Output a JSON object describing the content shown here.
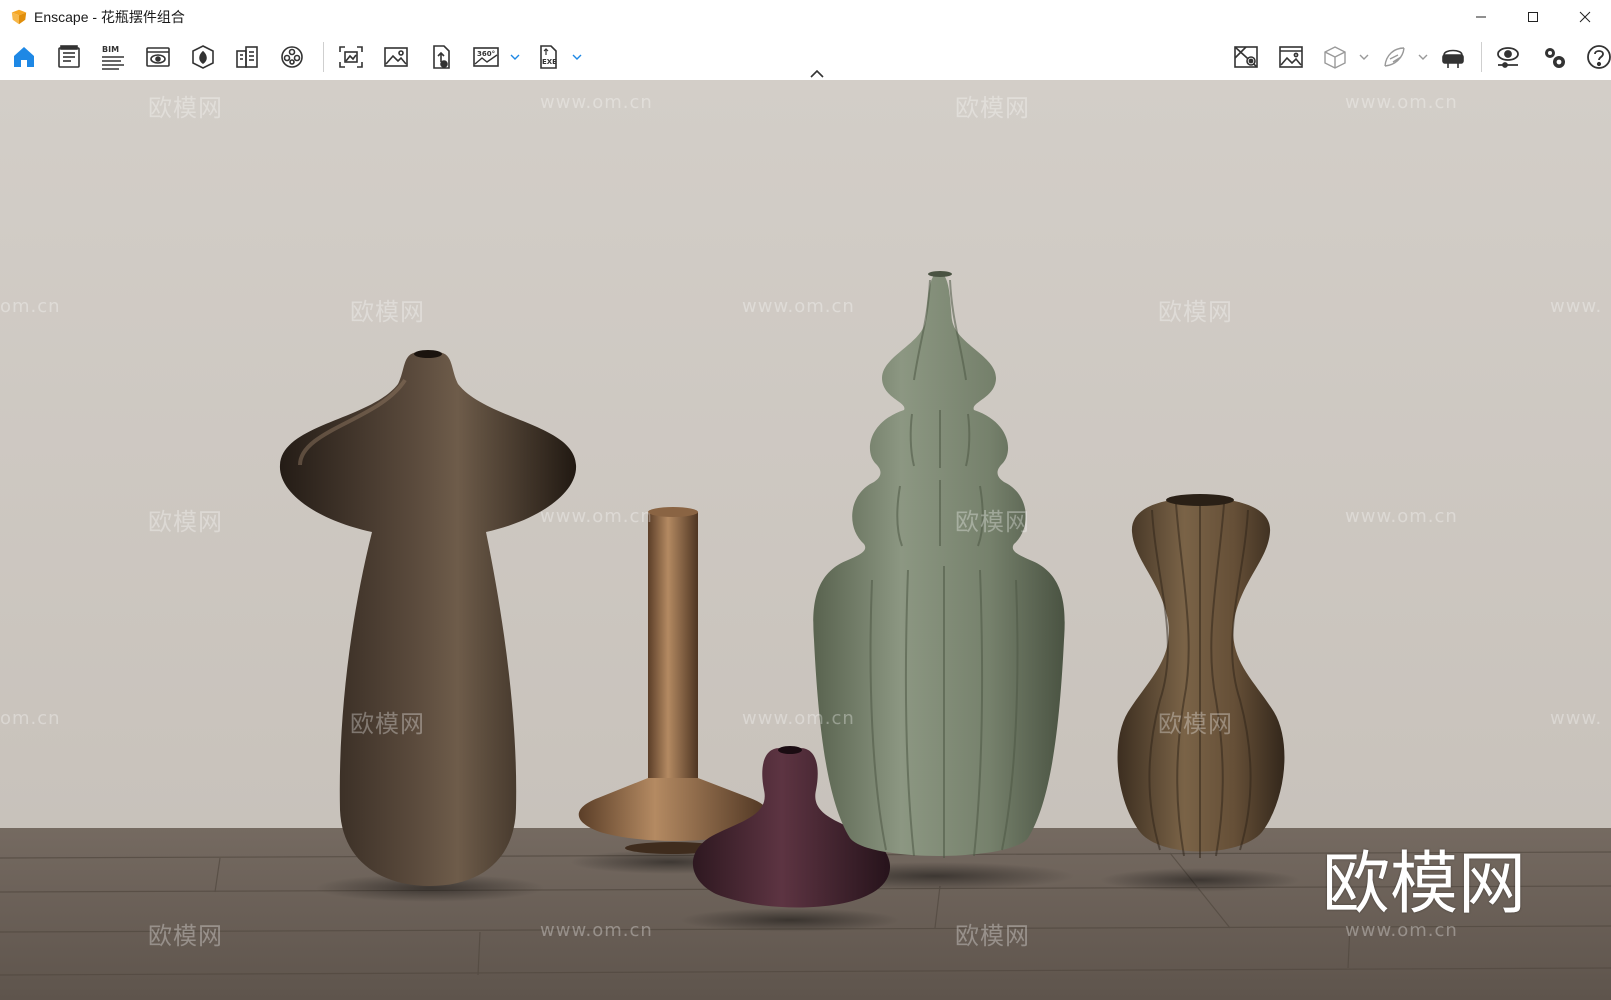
{
  "window": {
    "title": "Enscape - 花瓶摆件组合",
    "controls": [
      "minimize-icon",
      "maximize-icon",
      "close-icon"
    ]
  },
  "toolbar": {
    "left_icons": [
      "home-icon",
      "document-list-icon",
      "bim-icon",
      "view-eye-icon",
      "material-icon",
      "building-icon",
      "video-reel-icon",
      "screenshot-icon",
      "image-icon",
      "upload-file-icon",
      "panorama-360-icon",
      "export-exe-icon"
    ],
    "right_icons": [
      "map-pin-icon",
      "image-gallery-icon",
      "cube-icon",
      "feather-icon",
      "vr-headset-icon",
      "visual-settings-eye-icon",
      "settings-gears-icon",
      "help-icon"
    ],
    "bim_label": "BIM",
    "pano_label": "360°",
    "exe_label": "EXE"
  },
  "watermarks": {
    "logo_text": "欧模网",
    "url_text": "www.om.cn",
    "partial_url_left": "om.cn",
    "partial_url_right": "www.",
    "big_logo": "欧模网"
  },
  "colors": {
    "accent": "#1e88e5",
    "wall": "#d0cbc4",
    "floor": "#6b6159",
    "vase_bronze": "#3b2f25",
    "vase_copper": "#8a6443",
    "vase_green": "#7b8671",
    "vase_plum": "#4a2a35",
    "vase_brown": "#5d4a34"
  }
}
